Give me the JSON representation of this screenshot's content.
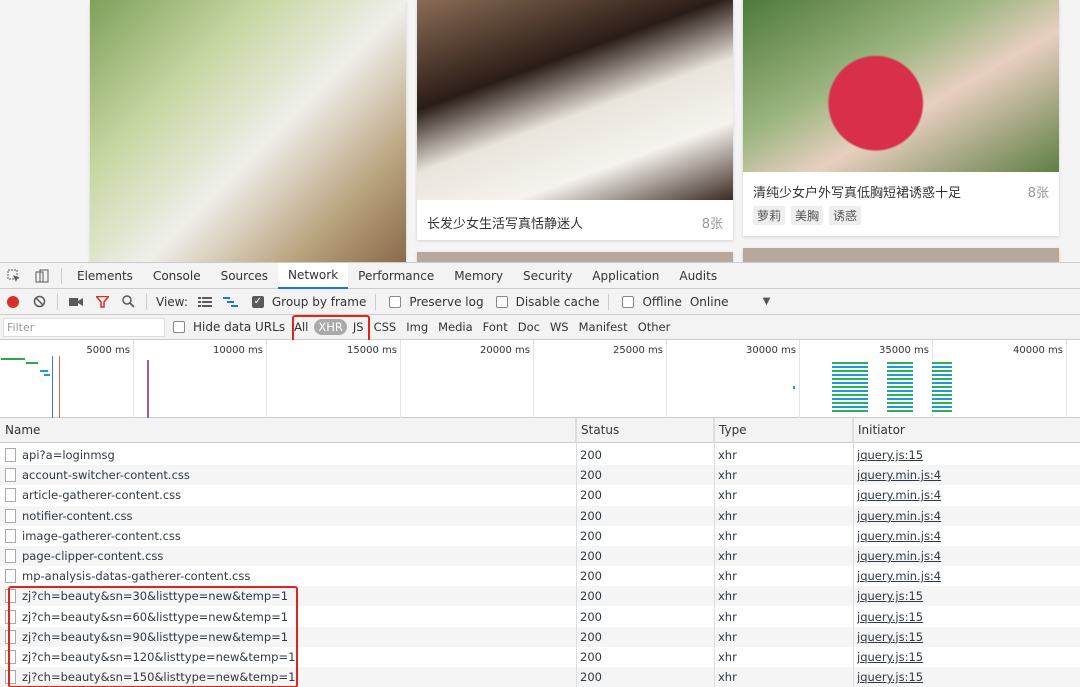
{
  "webpage": {
    "cards": [
      {
        "title": "",
        "count": ""
      },
      {
        "title": "长发少女生活写真恬静迷人",
        "count": "8张"
      },
      {
        "title": "清纯少女户外写真低胸短裙诱惑十足",
        "count": "8张",
        "tags": [
          "萝莉",
          "美胸",
          "诱惑"
        ]
      }
    ]
  },
  "devtools": {
    "tabs": [
      "Elements",
      "Console",
      "Sources",
      "Network",
      "Performance",
      "Memory",
      "Security",
      "Application",
      "Audits"
    ],
    "active_tab": "Network",
    "controls": {
      "view_label": "View:",
      "group_by_frame": "Group by frame",
      "preserve_log": "Preserve log",
      "disable_cache": "Disable cache",
      "offline": "Offline",
      "throttle": "Online"
    },
    "filter": {
      "placeholder": "Filter",
      "hide_data_urls": "Hide data URLs",
      "types": [
        "All",
        "XHR",
        "JS",
        "CSS",
        "Img",
        "Media",
        "Font",
        "Doc",
        "WS",
        "Manifest",
        "Other"
      ],
      "selected_type": "XHR"
    },
    "overview": {
      "ticks": [
        "5000 ms",
        "10000 ms",
        "15000 ms",
        "20000 ms",
        "25000 ms",
        "30000 ms",
        "35000 ms",
        "40000 ms"
      ]
    },
    "table": {
      "headers": [
        "Name",
        "Status",
        "Type",
        "Initiator"
      ],
      "rows": [
        {
          "name": "api?a=loginmsg",
          "status": "200",
          "type": "xhr",
          "initiator": "jquery.js:15"
        },
        {
          "name": "account-switcher-content.css",
          "status": "200",
          "type": "xhr",
          "initiator": "jquery.min.js:4"
        },
        {
          "name": "article-gatherer-content.css",
          "status": "200",
          "type": "xhr",
          "initiator": "jquery.min.js:4"
        },
        {
          "name": "notifier-content.css",
          "status": "200",
          "type": "xhr",
          "initiator": "jquery.min.js:4"
        },
        {
          "name": "image-gatherer-content.css",
          "status": "200",
          "type": "xhr",
          "initiator": "jquery.min.js:4"
        },
        {
          "name": "page-clipper-content.css",
          "status": "200",
          "type": "xhr",
          "initiator": "jquery.min.js:4"
        },
        {
          "name": "mp-analysis-datas-gatherer-content.css",
          "status": "200",
          "type": "xhr",
          "initiator": "jquery.min.js:4"
        },
        {
          "name": "zj?ch=beauty&sn=30&listtype=new&temp=1",
          "status": "200",
          "type": "xhr",
          "initiator": "jquery.js:15"
        },
        {
          "name": "zj?ch=beauty&sn=60&listtype=new&temp=1",
          "status": "200",
          "type": "xhr",
          "initiator": "jquery.js:15"
        },
        {
          "name": "zj?ch=beauty&sn=90&listtype=new&temp=1",
          "status": "200",
          "type": "xhr",
          "initiator": "jquery.js:15"
        },
        {
          "name": "zj?ch=beauty&sn=120&listtype=new&temp=1",
          "status": "200",
          "type": "xhr",
          "initiator": "jquery.js:15"
        },
        {
          "name": "zj?ch=beauty&sn=150&listtype=new&temp=1",
          "status": "200",
          "type": "xhr",
          "initiator": "jquery.js:15"
        }
      ]
    }
  },
  "colors": {
    "accent": "#1a73e8",
    "record": "#d93025",
    "highlight_box": "#e0241b"
  }
}
